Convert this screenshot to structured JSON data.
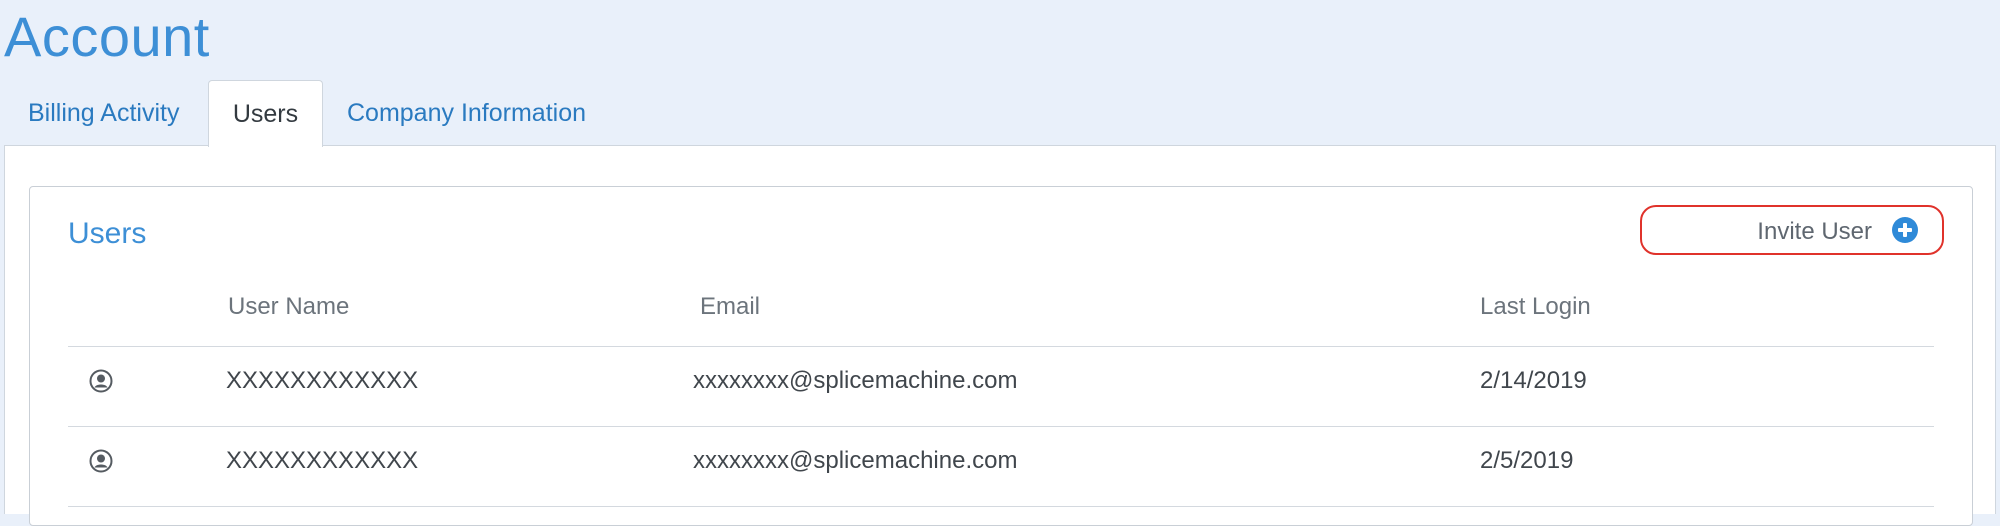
{
  "page": {
    "title": "Account"
  },
  "tabs": [
    {
      "label": "Billing Activity",
      "active": false
    },
    {
      "label": "Users",
      "active": true
    },
    {
      "label": "Company Information",
      "active": false
    }
  ],
  "users_panel": {
    "title": "Users",
    "invite_button": {
      "label": "Invite User",
      "icon": "plus-circle-icon",
      "highlight_color": "#e0322b"
    },
    "columns": [
      "User Name",
      "Email",
      "Last Login"
    ],
    "rows": [
      {
        "icon": "user-circle-icon",
        "user_name": "XXXXXXXXXXXX",
        "email": "xxxxxxxx@splicemachine.com",
        "last_login": "2/14/2019"
      },
      {
        "icon": "user-circle-icon",
        "user_name": "XXXXXXXXXXXX",
        "email": "xxxxxxxx@splicemachine.com",
        "last_login": "2/5/2019"
      }
    ]
  },
  "colors": {
    "accent": "#3d8fd6",
    "tab_link": "#2a7ac0",
    "background": "#e9f0fa"
  }
}
